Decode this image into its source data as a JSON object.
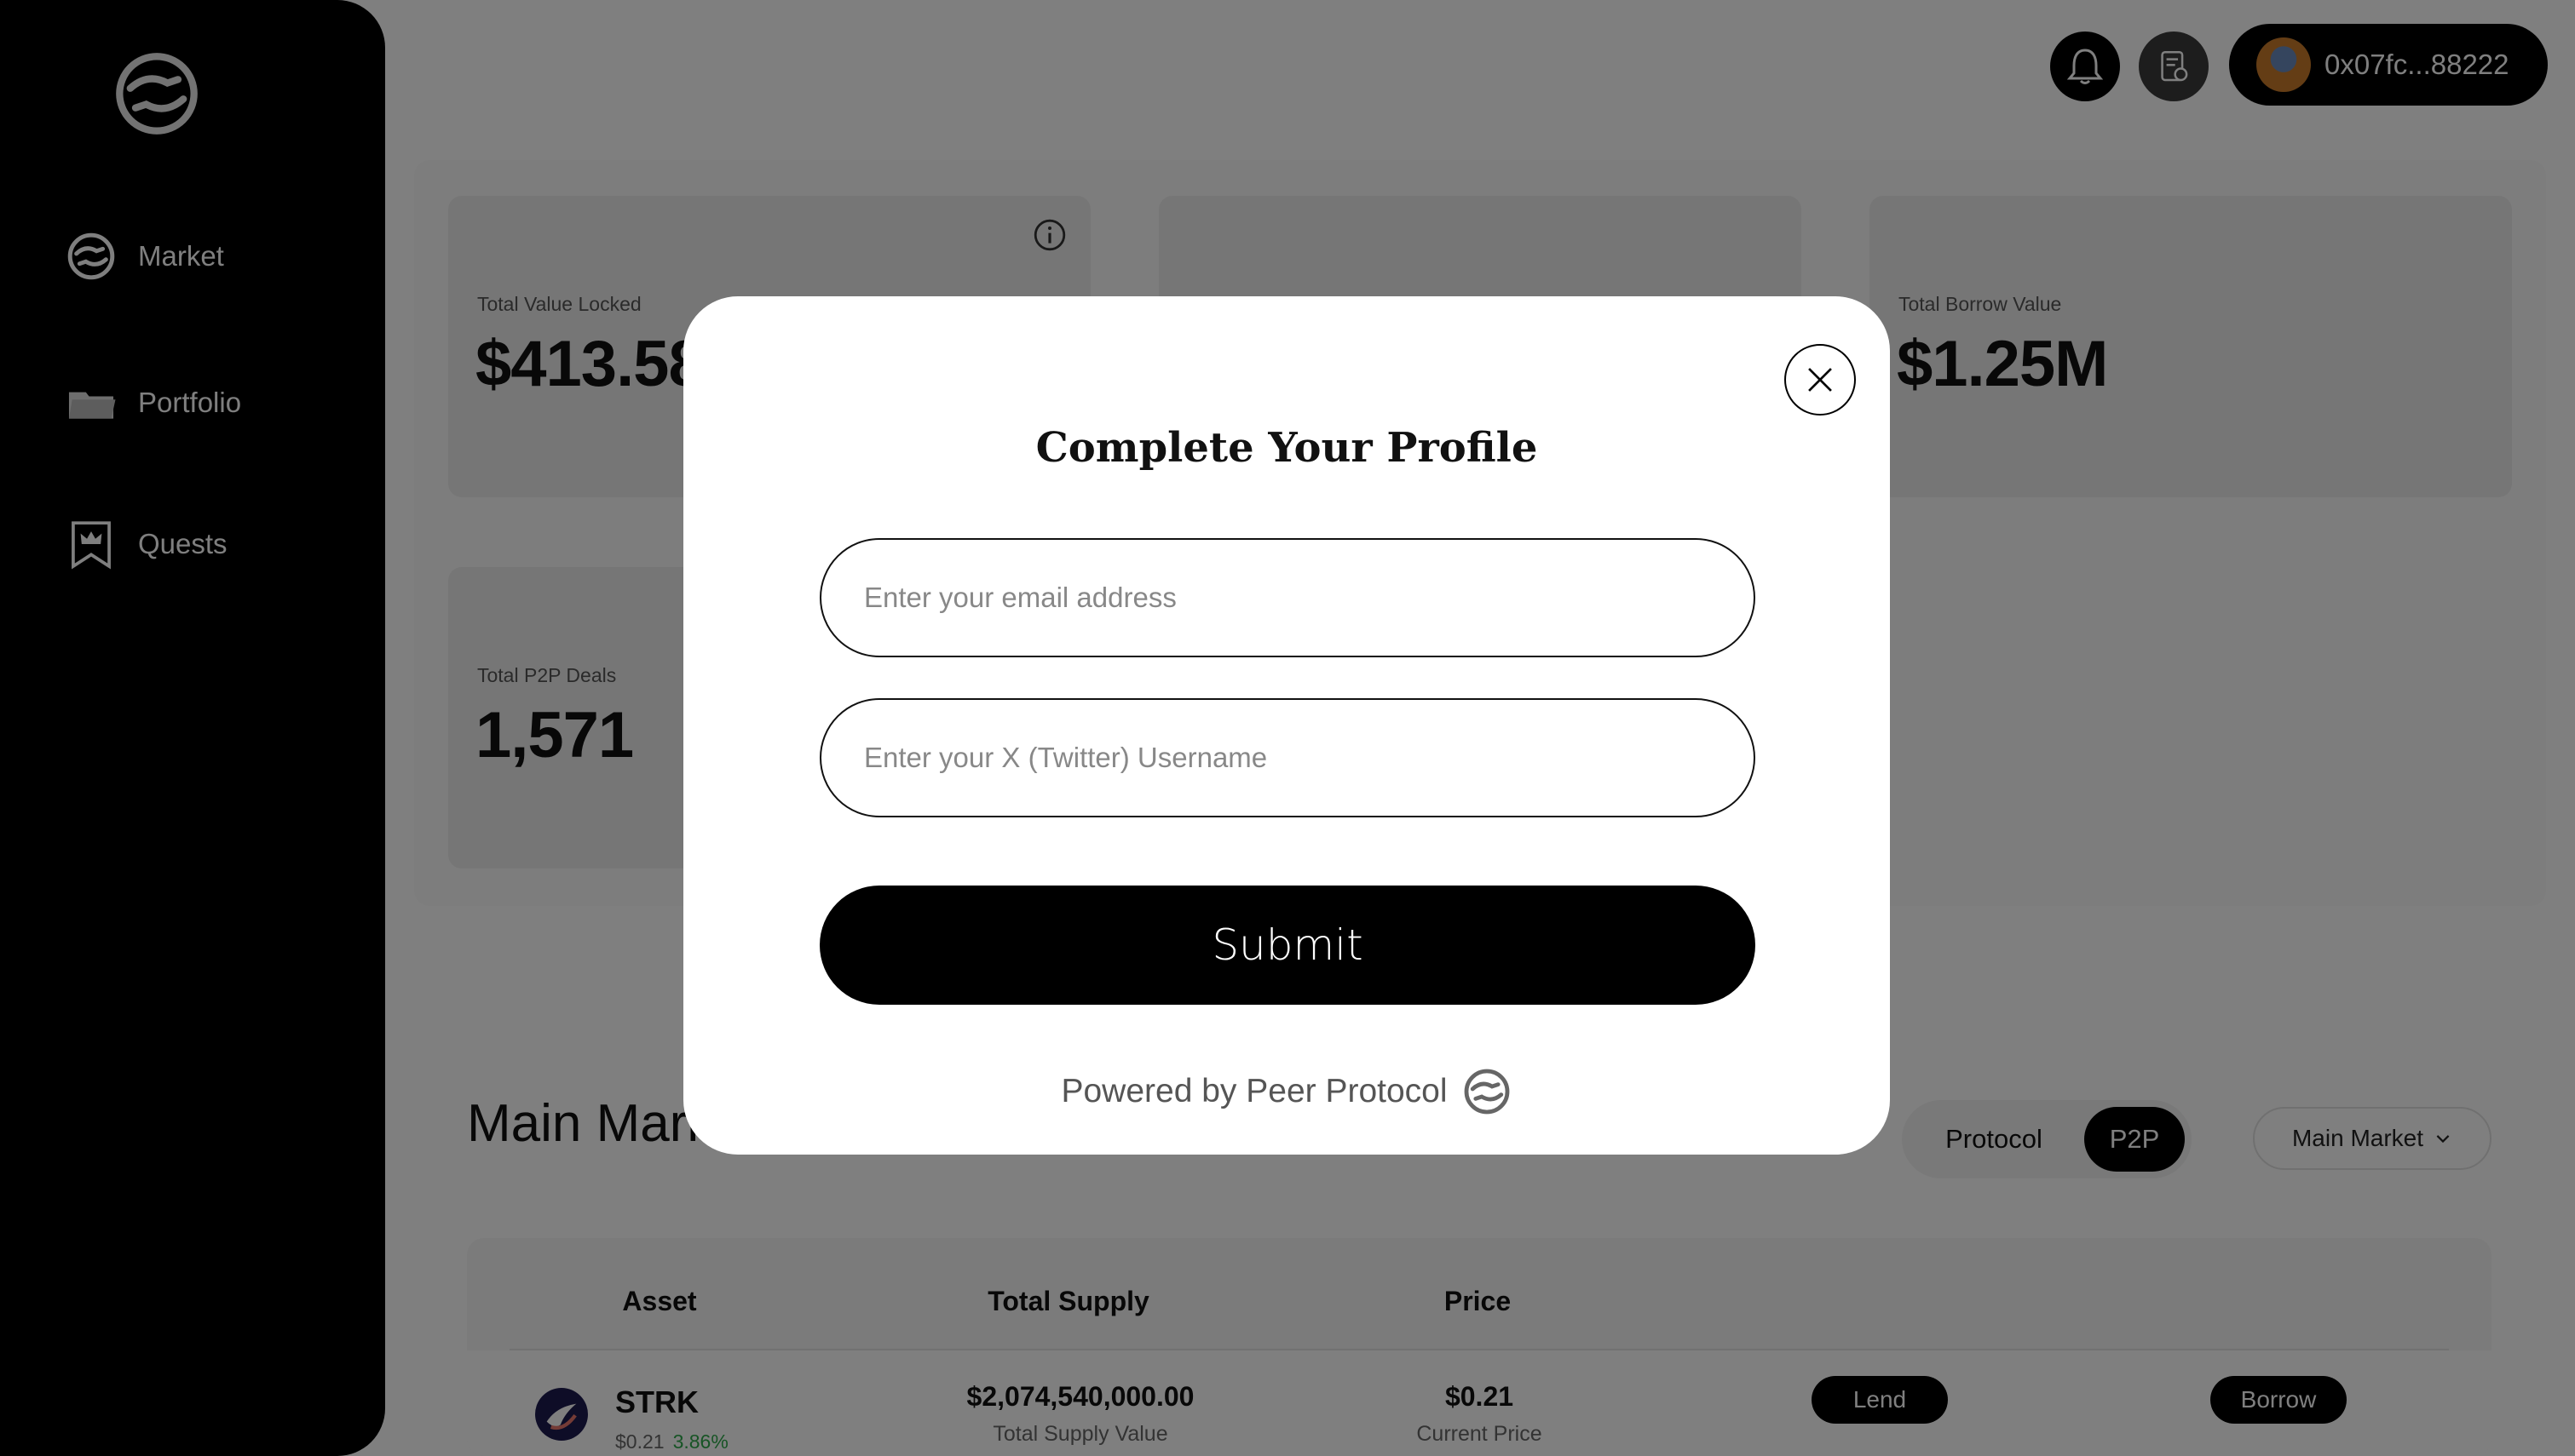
{
  "sidebar": {
    "logo_icon": "peer-protocol-logo-icon",
    "items": [
      {
        "label": "Market",
        "icon": "handshake-icon"
      },
      {
        "label": "Portfolio",
        "icon": "folder-icon"
      },
      {
        "label": "Quests",
        "icon": "crown-bookmark-icon"
      }
    ]
  },
  "header": {
    "notification_icon": "bell-icon",
    "document_icon": "document-icon",
    "wallet_address": "0x07fc...88222"
  },
  "stats": {
    "tvl": {
      "label": "Total Value Locked",
      "value": "$413.58"
    },
    "tbv": {
      "label": "Total Borrow Value",
      "value": "$1.25M"
    },
    "p2p": {
      "label": "Total P2P Deals",
      "value": "1,571"
    }
  },
  "market": {
    "title": "Main Market",
    "toggle": {
      "protocol": "Protocol",
      "p2p": "P2P",
      "selected": "P2P"
    },
    "select_value": "Main Market",
    "columns": [
      "Asset",
      "Total Supply",
      "Price"
    ],
    "rows": [
      {
        "asset": "STRK",
        "asset_price": "$0.21",
        "asset_change": "3.86%",
        "total_supply": "$2,074,540,000.00",
        "total_supply_label": "Total Supply Value",
        "price": "$0.21",
        "price_label": "Current Price",
        "lend_label": "Lend",
        "borrow_label": "Borrow"
      }
    ]
  },
  "modal": {
    "title": "Complete Your Profile",
    "email_placeholder": "Enter your email address",
    "twitter_placeholder": "Enter your X (Twitter) Username",
    "submit_label": "Submit",
    "powered_by": "Powered by Peer Protocol"
  },
  "colors": {
    "sidebar_bg": "#000000",
    "overlay": "rgba(0,0,0,0.5)",
    "positive": "#2ea84a"
  }
}
